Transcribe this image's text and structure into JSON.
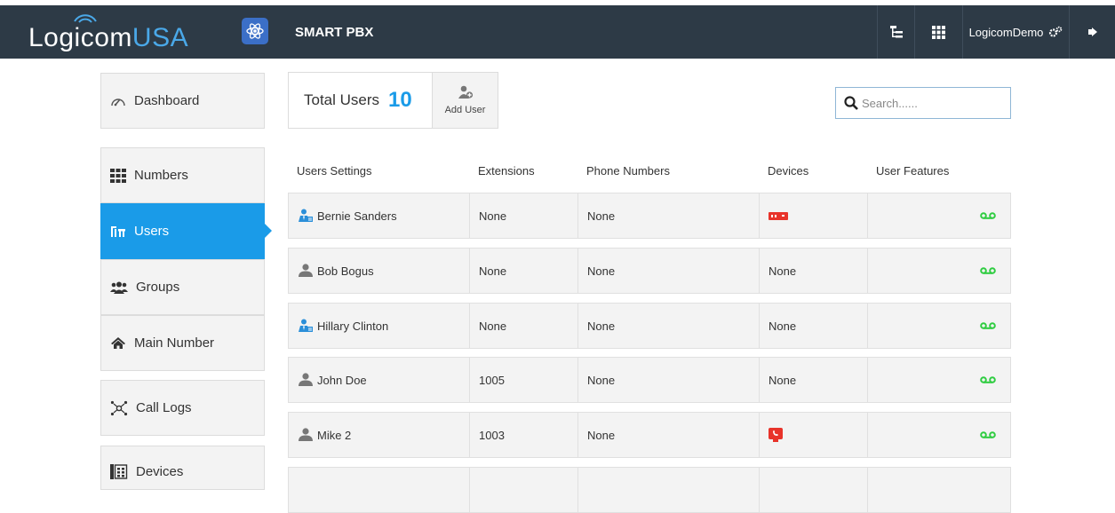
{
  "header": {
    "logo_main": "Logicom",
    "logo_accent": "USA",
    "app_title": "SMART PBX",
    "user_name": "LogicomDemo"
  },
  "sidebar": {
    "items": [
      {
        "label": "Dashboard",
        "icon": "dashboard-gauge-icon"
      },
      {
        "label": "Numbers",
        "icon": "grid-icon"
      },
      {
        "label": "Users",
        "icon": "users-icon",
        "active": true
      },
      {
        "label": "Groups",
        "icon": "group-icon"
      },
      {
        "label": "Main Number",
        "icon": "home-icon"
      },
      {
        "label": "Call Logs",
        "icon": "call-logs-icon"
      },
      {
        "label": "Devices",
        "icon": "devices-icon"
      }
    ]
  },
  "summary": {
    "total_label": "Total Users",
    "total_count": "10",
    "add_user_label": "Add User"
  },
  "search": {
    "placeholder": "Search......"
  },
  "table": {
    "headers": [
      "Users Settings",
      "Extensions",
      "Phone Numbers",
      "Devices",
      "User Features"
    ],
    "rows": [
      {
        "name": "Bernie Sanders",
        "avatar": "admin-user-icon",
        "extension": "None",
        "phone": "None",
        "device": "",
        "device_icon": "desk-phone-icon",
        "feature_icon": "voicemail-icon"
      },
      {
        "name": "Bob Bogus",
        "avatar": "user-icon",
        "extension": "None",
        "phone": "None",
        "device": "None",
        "feature_icon": "voicemail-icon"
      },
      {
        "name": "Hillary Clinton",
        "avatar": "admin-user-icon",
        "extension": "None",
        "phone": "None",
        "device": "None",
        "feature_icon": "voicemail-icon"
      },
      {
        "name": "John Doe",
        "avatar": "user-icon",
        "extension": "1005",
        "phone": "None",
        "device": "None",
        "feature_icon": "voicemail-icon"
      },
      {
        "name": "Mike 2",
        "avatar": "user-icon",
        "extension": "1003",
        "phone": "None",
        "device": "",
        "device_icon": "softphone-icon",
        "feature_icon": "voicemail-icon"
      },
      {
        "name": "",
        "avatar": "",
        "extension": "",
        "phone": "",
        "device": ""
      }
    ]
  },
  "colors": {
    "topbar": "#2d3a46",
    "accent": "#1a9be8",
    "voicemail": "#2ecc40",
    "device": "#e8332a"
  }
}
